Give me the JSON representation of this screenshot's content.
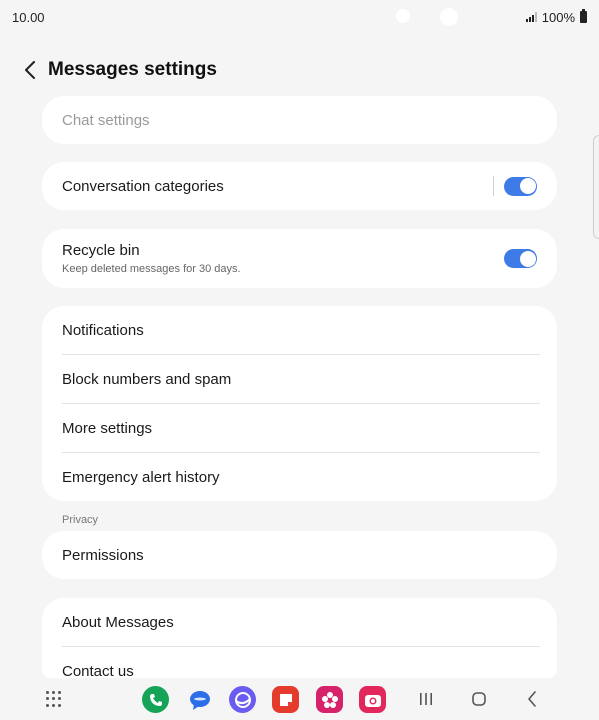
{
  "status_bar": {
    "time": "10.00",
    "battery": "100%"
  },
  "header": {
    "title": "Messages settings"
  },
  "chat_settings": {
    "label": "Chat settings"
  },
  "conversation_categories": {
    "label": "Conversation categories",
    "enabled": true
  },
  "recycle_bin": {
    "label": "Recycle bin",
    "description": "Keep deleted messages for 30 days.",
    "enabled": true
  },
  "menu_items": [
    {
      "label": "Notifications"
    },
    {
      "label": "Block numbers and spam"
    },
    {
      "label": "More settings"
    },
    {
      "label": "Emergency alert history"
    }
  ],
  "privacy": {
    "section_label": "Privacy",
    "permissions": "Permissions"
  },
  "about": {
    "about_messages": "About Messages",
    "contact_us": "Contact us"
  },
  "colors": {
    "toggle_on": "#3e7be6",
    "phone": "#14a357",
    "messages": "#2b6ee8",
    "internet": "#6a5cf0",
    "notes": "#e53b2c",
    "gallery": "#d6226b",
    "camera": "#e2285a"
  },
  "dock_icons": [
    "phone-icon",
    "messages-icon",
    "internet-icon",
    "notes-icon",
    "gallery-icon",
    "camera-icon"
  ]
}
